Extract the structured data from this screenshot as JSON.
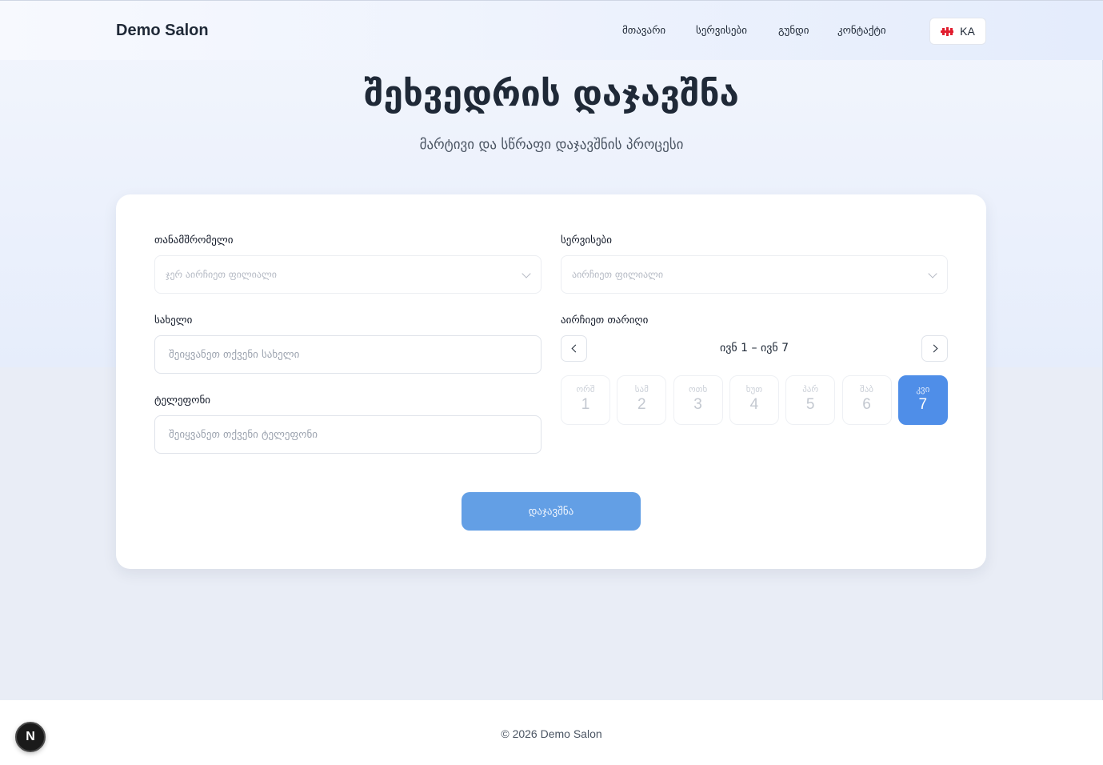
{
  "header": {
    "brand": "Demo Salon",
    "nav": [
      "მთავარი",
      "სერვისები",
      "გუნდი",
      "კონტაქტი"
    ],
    "language": "KA",
    "language_icon": "georgia-flag-icon"
  },
  "hero": {
    "title": "შეხვედრის დაჯავშნა",
    "subtitle": "მარტივი და სწრაფი დაჯავშნის პროცესი"
  },
  "form": {
    "employee": {
      "label": "თანამშრომელი",
      "placeholder": "ჯერ აირჩიეთ ფილიალი"
    },
    "service": {
      "label": "სერვისები",
      "placeholder": "აირჩიეთ ფილიალი"
    },
    "name": {
      "label": "სახელი",
      "placeholder": "შეიყვანეთ თქვენი სახელი"
    },
    "phone": {
      "label": "ტელეფონი",
      "placeholder": "შეიყვანეთ თქვენი ტელეფონი"
    },
    "date": {
      "label": "აირჩიეთ თარიღი",
      "range": "ივნ 1 – ივნ 7",
      "days": [
        {
          "dow": "ორშ",
          "num": "1",
          "selected": false
        },
        {
          "dow": "სამ",
          "num": "2",
          "selected": false
        },
        {
          "dow": "ოთხ",
          "num": "3",
          "selected": false
        },
        {
          "dow": "ხუთ",
          "num": "4",
          "selected": false
        },
        {
          "dow": "პარ",
          "num": "5",
          "selected": false
        },
        {
          "dow": "შაბ",
          "num": "6",
          "selected": false
        },
        {
          "dow": "კვი",
          "num": "7",
          "selected": true
        }
      ]
    },
    "submit": "დაჯავშნა"
  },
  "footer": {
    "copyright": "© 2026 Demo Salon"
  },
  "dev_badge": "N",
  "colors": {
    "accent": "#4f8ee8",
    "submit": "#639fe5"
  }
}
